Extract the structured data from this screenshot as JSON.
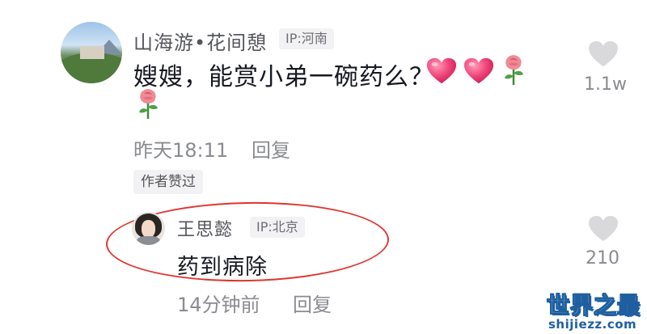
{
  "comment": {
    "username": "山海游•花间憩",
    "ip": "IP:河南",
    "text": "嫂嫂，能赏小弟一碗药么？",
    "time": "昨天18:11",
    "reply_label": "回复",
    "author_liked": "作者赞过",
    "like_count": "1.1w",
    "emojis": [
      "heart-emoji",
      "heart-emoji",
      "rose-emoji",
      "rose-emoji"
    ]
  },
  "reply": {
    "username": "王思懿",
    "ip": "IP:北京",
    "text": "药到病除",
    "time": "14分钟前",
    "reply_label": "回复",
    "like_count": "210"
  },
  "watermark": {
    "main": "世界之最",
    "sub": "shijiezz.com"
  },
  "colors": {
    "highlight": "#e0342f",
    "like_icon": "#d9d9dc",
    "heart": "#f0457a",
    "watermark": "#1f5fa0"
  }
}
